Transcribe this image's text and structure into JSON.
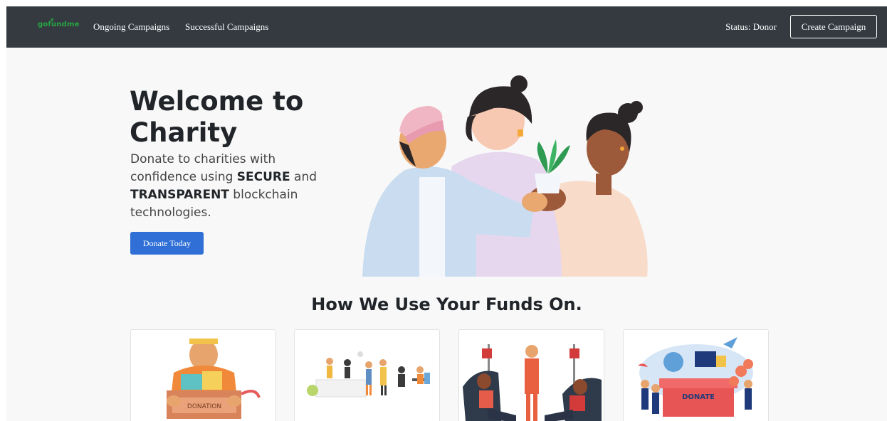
{
  "navbar": {
    "brand": "gofundme",
    "links": [
      "Ongoing Campaigns",
      "Successful Campaigns"
    ],
    "status": "Status: Donor",
    "create_button": "Create Campaign"
  },
  "hero": {
    "title": "Welcome to Charity",
    "subtitle_parts": [
      "Donate to charities with confidence using ",
      "SECURE",
      " and ",
      "TRANSPARENT",
      " blockchain technologies."
    ],
    "donate_button": "Donate Today"
  },
  "section": {
    "title": "How We Use Your Funds On."
  },
  "cards": [
    {
      "name": "donation-box",
      "label": "DONATION"
    },
    {
      "name": "community-meeting"
    },
    {
      "name": "blood-donation"
    },
    {
      "name": "donate-fundraising",
      "label": "DONATE"
    }
  ],
  "colors": {
    "navbar": "#343a40",
    "brand": "#28a745",
    "primary": "#2f6fd6",
    "background": "#f8f8f8"
  }
}
